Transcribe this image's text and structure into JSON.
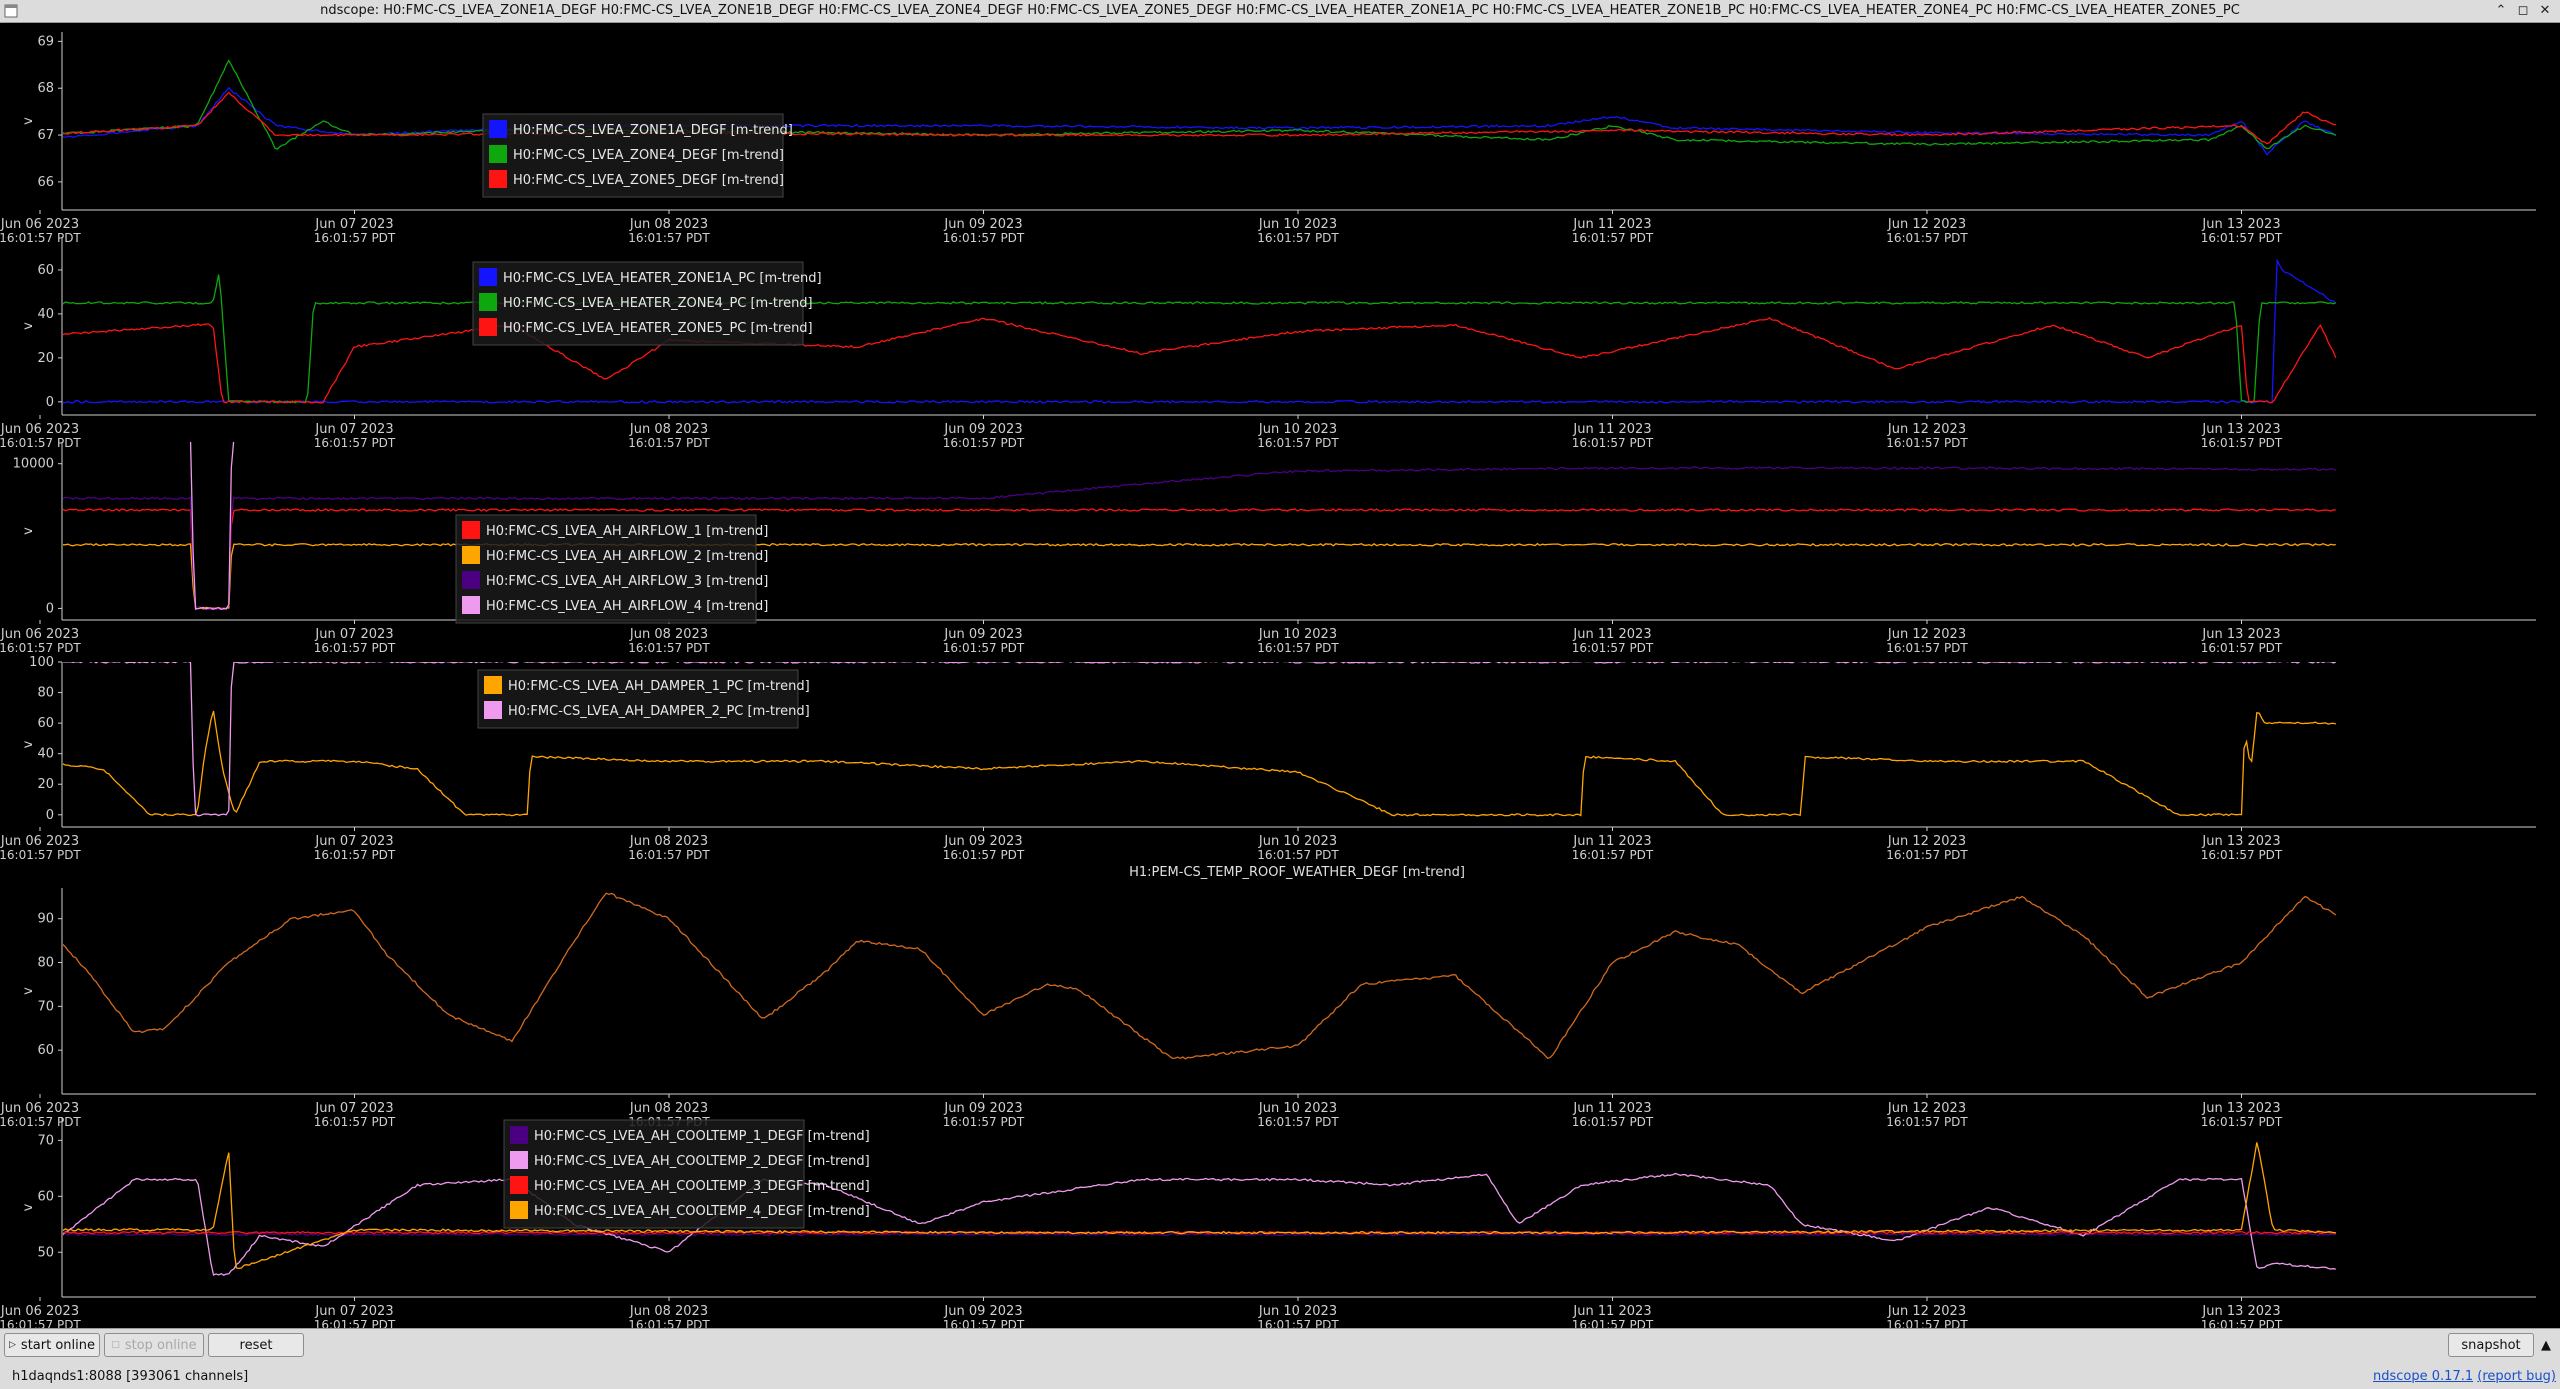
{
  "window": {
    "title": "ndscope: H0:FMC-CS_LVEA_ZONE1A_DEGF H0:FMC-CS_LVEA_ZONE1B_DEGF H0:FMC-CS_LVEA_ZONE4_DEGF H0:FMC-CS_LVEA_ZONE5_DEGF H0:FMC-CS_LVEA_HEATER_ZONE1A_PC H0:FMC-CS_LVEA_HEATER_ZONE1B_PC H0:FMC-CS_LVEA_HEATER_ZONE4_PC H0:FMC-CS_LVEA_HEATER_ZONE5_PC",
    "controls": {
      "minimize": "⌃",
      "maximize": "◻",
      "close": "✕"
    }
  },
  "time_axis": {
    "dates": [
      "Jun 06 2023",
      "Jun 07 2023",
      "Jun 08 2023",
      "Jun 09 2023",
      "Jun 10 2023",
      "Jun 11 2023",
      "Jun 12 2023",
      "Jun 13 2023"
    ],
    "time_label": "16:01:57 PDT"
  },
  "colors": {
    "background": "#000000",
    "axis": "#cfcfcf",
    "blue": "#1414ff",
    "green": "#0ea80e",
    "red": "#ff1414",
    "orange": "#ffa500",
    "purple": "#4b0082",
    "pink": "#ee9aee",
    "brown": "#d2691e"
  },
  "chart_data": [
    {
      "type": "line",
      "ylabel": "v",
      "ylim": [
        65.4,
        69.2
      ],
      "yticks": [
        66,
        67,
        68,
        69
      ],
      "legend_position": "top-left",
      "series": [
        {
          "name": "H0:FMC-CS_LVEA_ZONE1A_DEGF [m-trend]",
          "color": "#1414ff",
          "x": [
            0,
            0.5,
            0.6,
            0.75,
            1.0,
            1.5,
            2.0,
            3.0,
            4.0,
            4.8,
            5.0,
            5.2,
            6.0,
            6.9,
            7.0,
            7.08,
            7.2,
            7.3
          ],
          "y": [
            66.9,
            67.2,
            68.0,
            67.2,
            67.0,
            67.15,
            67.2,
            67.2,
            67.15,
            67.2,
            67.4,
            67.15,
            67.05,
            67.0,
            67.3,
            66.6,
            67.3,
            67.0
          ]
        },
        {
          "name": "H0:FMC-CS_LVEA_ZONE4_DEGF [m-trend]",
          "color": "#0ea80e",
          "x": [
            0,
            0.5,
            0.6,
            0.75,
            0.9,
            1.0,
            1.5,
            2.0,
            3.0,
            4.0,
            4.8,
            5.0,
            5.2,
            6.0,
            6.9,
            7.0,
            7.08,
            7.2,
            7.3
          ],
          "y": [
            67.0,
            67.2,
            68.6,
            66.7,
            67.3,
            67.0,
            67.1,
            67.1,
            67.0,
            67.1,
            66.9,
            67.2,
            66.9,
            66.8,
            66.9,
            67.2,
            66.7,
            67.2,
            67.0
          ]
        },
        {
          "name": "H0:FMC-CS_LVEA_ZONE5_DEGF [m-trend]",
          "color": "#ff1414",
          "x": [
            0,
            0.5,
            0.6,
            0.75,
            1.0,
            2.0,
            3.0,
            4.0,
            5.0,
            6.0,
            7.0,
            7.08,
            7.2,
            7.3
          ],
          "y": [
            67.0,
            67.2,
            67.9,
            67.0,
            67.0,
            67.05,
            67.0,
            67.0,
            67.1,
            67.0,
            67.2,
            66.8,
            67.5,
            67.2
          ]
        }
      ]
    },
    {
      "type": "line",
      "ylabel": "v",
      "ylim": [
        -6,
        75
      ],
      "yticks": [
        0,
        20,
        40,
        60
      ],
      "legend_position": "top-left",
      "series": [
        {
          "name": "H0:FMC-CS_LVEA_HEATER_ZONE1A_PC [m-trend]",
          "color": "#1414ff",
          "x": [
            0,
            7.1,
            7.11,
            7.13,
            7.3
          ],
          "y": [
            0,
            0,
            65,
            60,
            45
          ]
        },
        {
          "name": "H0:FMC-CS_LVEA_HEATER_ZONE4_PC [m-trend]",
          "color": "#0ea80e",
          "x": [
            0,
            0.55,
            0.57,
            0.6,
            0.62,
            0.85,
            0.87,
            1.0,
            2.0,
            3.0,
            4.0,
            5.0,
            6.0,
            6.98,
            7.0,
            7.04,
            7.06,
            7.3
          ],
          "y": [
            45,
            45,
            60,
            0,
            0,
            0,
            45,
            45,
            45,
            45,
            45,
            45,
            45,
            45,
            0,
            0,
            45,
            45
          ]
        },
        {
          "name": "H0:FMC-CS_LVEA_HEATER_ZONE5_PC [m-trend]",
          "color": "#ff1414",
          "x": [
            0,
            0.5,
            0.55,
            0.58,
            0.62,
            0.9,
            1.0,
            1.5,
            1.8,
            2.0,
            2.6,
            3.0,
            3.5,
            4.0,
            4.5,
            4.9,
            5.5,
            5.9,
            6.4,
            6.7,
            7.0,
            7.02,
            7.1,
            7.25,
            7.3
          ],
          "y": [
            30,
            35,
            35,
            0,
            0,
            0,
            25,
            35,
            10,
            28,
            25,
            38,
            22,
            32,
            35,
            20,
            38,
            15,
            35,
            20,
            35,
            0,
            0,
            35,
            20
          ]
        }
      ]
    },
    {
      "type": "line",
      "ylabel": "v",
      "ylim": [
        -800,
        11500
      ],
      "yticks": [
        0,
        10000
      ],
      "legend_position": "top-left",
      "series": [
        {
          "name": "H0:FMC-CS_LVEA_AH_AIRFLOW_1 [m-trend]",
          "color": "#ff1414",
          "x": [
            0,
            0.48,
            0.49,
            0.6,
            0.61,
            7.3
          ],
          "y": [
            6800,
            6800,
            0,
            0,
            6800,
            6800
          ]
        },
        {
          "name": "H0:FMC-CS_LVEA_AH_AIRFLOW_2 [m-trend]",
          "color": "#ffa500",
          "x": [
            0,
            0.48,
            0.49,
            0.6,
            0.61,
            7.3
          ],
          "y": [
            4400,
            4400,
            0,
            0,
            4400,
            4400
          ]
        },
        {
          "name": "H0:FMC-CS_LVEA_AH_AIRFLOW_3 [m-trend]",
          "color": "#4b0082",
          "x": [
            0,
            0.48,
            0.49,
            0.6,
            0.61,
            3.0,
            3.5,
            4.0,
            5.0,
            6.0,
            7.3
          ],
          "y": [
            7600,
            7600,
            0,
            0,
            7600,
            7600,
            8600,
            9500,
            9700,
            9700,
            9600
          ]
        },
        {
          "name": "H0:FMC-CS_LVEA_AH_AIRFLOW_4 [m-trend]",
          "color": "#ee9aee",
          "x": [
            0,
            0.48,
            0.49,
            0.6,
            0.61,
            7.3
          ],
          "y": [
            11700,
            11700,
            0,
            0,
            11700,
            11700
          ]
        }
      ]
    },
    {
      "type": "line",
      "ylabel": "v",
      "ylim": [
        -8,
        100
      ],
      "yticks": [
        0,
        20,
        40,
        60,
        80,
        100
      ],
      "legend_position": "top-left",
      "series": [
        {
          "name": "H0:FMC-CS_LVEA_AH_DAMPER_1_PC [m-trend]",
          "color": "#ffa500",
          "x": [
            0,
            0.2,
            0.35,
            0.5,
            0.52,
            0.55,
            0.58,
            0.62,
            0.7,
            1.0,
            1.2,
            1.35,
            1.55,
            1.56,
            2.0,
            2.5,
            3.0,
            3.5,
            4.0,
            4.3,
            4.6,
            4.9,
            4.91,
            5.2,
            5.35,
            5.6,
            5.61,
            6.0,
            6.5,
            6.8,
            7.0,
            7.01,
            7.03,
            7.05,
            7.07,
            7.3
          ],
          "y": [
            35,
            30,
            0,
            0,
            35,
            70,
            30,
            0,
            35,
            35,
            30,
            0,
            0,
            38,
            35,
            35,
            30,
            35,
            28,
            0,
            0,
            0,
            38,
            35,
            0,
            0,
            38,
            35,
            35,
            0,
            0,
            55,
            30,
            70,
            60,
            60
          ]
        },
        {
          "name": "H0:FMC-CS_LVEA_AH_DAMPER_2_PC [m-trend]",
          "color": "#ee9aee",
          "x": [
            0,
            0.48,
            0.49,
            0.6,
            0.61,
            7.3
          ],
          "y": [
            100,
            100,
            0,
            0,
            100,
            100
          ]
        }
      ]
    },
    {
      "type": "line",
      "title": "H1:PEM-CS_TEMP_ROOF_WEATHER_DEGF [m-trend]",
      "ylabel": "v",
      "ylim": [
        50,
        97
      ],
      "yticks": [
        60,
        70,
        80,
        90
      ],
      "series": [
        {
          "name": "H1:PEM-CS_TEMP_ROOF_WEATHER_DEGF [m-trend]",
          "color": "#d2691e",
          "x": [
            0,
            0.15,
            0.3,
            0.4,
            0.6,
            0.8,
            1.0,
            1.1,
            1.3,
            1.5,
            1.7,
            1.8,
            2.0,
            2.3,
            2.5,
            2.6,
            2.8,
            3.0,
            3.2,
            3.3,
            3.6,
            4.0,
            4.2,
            4.5,
            4.8,
            5.0,
            5.2,
            5.4,
            5.6,
            6.0,
            6.3,
            6.5,
            6.7,
            7.0,
            7.2,
            7.3
          ],
          "y": [
            90,
            78,
            64,
            65,
            80,
            90,
            92,
            82,
            68,
            62,
            85,
            96,
            90,
            67,
            78,
            85,
            83,
            68,
            75,
            74,
            58,
            61,
            75,
            77,
            58,
            80,
            87,
            84,
            73,
            88,
            95,
            86,
            72,
            80,
            95,
            91
          ]
        }
      ]
    },
    {
      "type": "line",
      "ylabel": "v",
      "ylim": [
        42,
        74
      ],
      "yticks": [
        50,
        60,
        70
      ],
      "legend_position": "top-left",
      "series": [
        {
          "name": "H0:FMC-CS_LVEA_AH_COOLTEMP_1_DEGF [m-trend]",
          "color": "#4b0082",
          "x": [
            0,
            7.3
          ],
          "y": [
            53.2,
            53.2
          ]
        },
        {
          "name": "H0:FMC-CS_LVEA_AH_COOLTEMP_2_DEGF [m-trend]",
          "color": "#ee9aee",
          "x": [
            0,
            0.3,
            0.5,
            0.55,
            0.6,
            0.7,
            0.9,
            1.2,
            1.5,
            1.7,
            2.0,
            2.3,
            2.5,
            2.8,
            3.0,
            3.5,
            3.8,
            4.0,
            4.3,
            4.6,
            4.7,
            4.9,
            5.2,
            5.5,
            5.6,
            5.9,
            6.2,
            6.5,
            6.8,
            7.0,
            7.05,
            7.1,
            7.3
          ],
          "y": [
            50,
            63,
            63,
            46,
            46,
            53,
            51,
            62,
            63,
            55,
            50,
            63,
            62,
            55,
            59,
            63,
            63,
            63,
            62,
            64,
            55,
            62,
            64,
            62,
            55,
            52,
            58,
            53,
            63,
            63,
            47,
            48,
            47
          ]
        },
        {
          "name": "H0:FMC-CS_LVEA_AH_COOLTEMP_3_DEGF [m-trend]",
          "color": "#ff1414",
          "x": [
            0,
            7.3
          ],
          "y": [
            53.5,
            53.5
          ]
        },
        {
          "name": "H0:FMC-CS_LVEA_AH_COOLTEMP_4_DEGF [m-trend]",
          "color": "#ffa500",
          "x": [
            0,
            0.55,
            0.6,
            0.62,
            1.0,
            3.0,
            5.0,
            7.0,
            7.05,
            7.1,
            7.3
          ],
          "y": [
            54,
            54,
            68,
            47,
            54,
            53.5,
            53.5,
            54,
            70,
            54,
            53.5
          ]
        }
      ]
    }
  ],
  "toolbar": {
    "start_online": "start online",
    "stop_online": "stop online",
    "reset": "reset",
    "snapshot": "snapshot",
    "collapse": "▲"
  },
  "status": {
    "server": "h1daqnds1:8088  [393061 channels]",
    "version": "ndscope 0.17.1",
    "report": "(report bug)"
  }
}
